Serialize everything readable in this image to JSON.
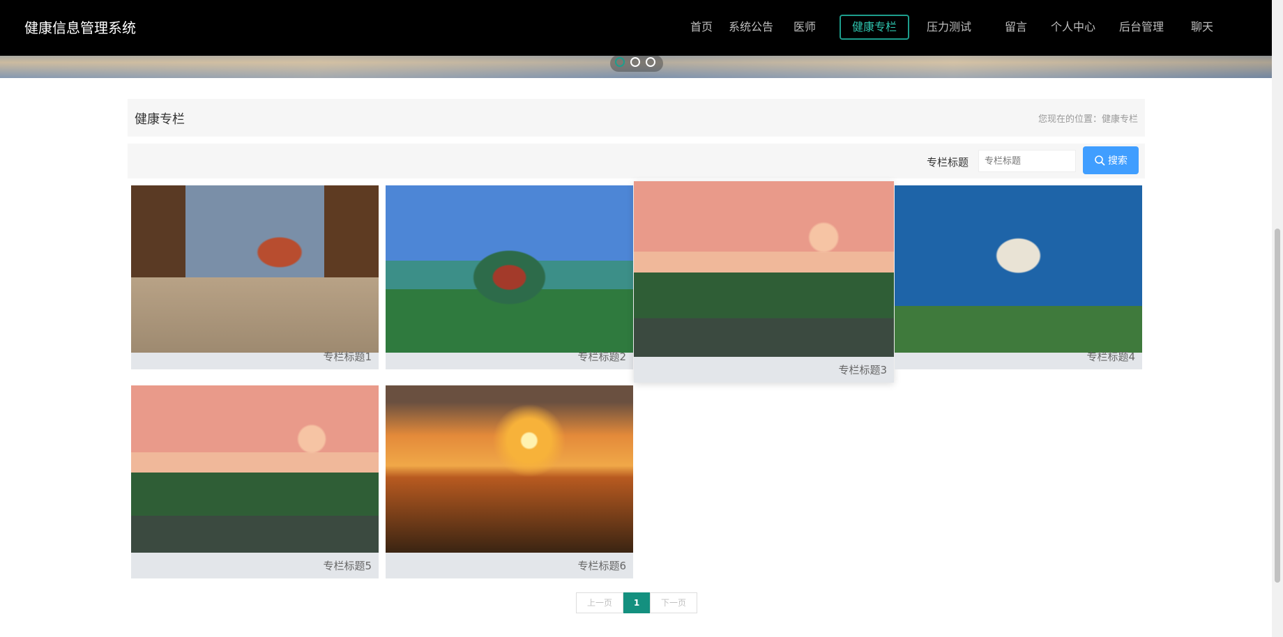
{
  "app": {
    "title": "健康信息管理系统"
  },
  "nav": {
    "items": [
      {
        "label": "首页"
      },
      {
        "label": "系统公告"
      },
      {
        "label": "医师"
      },
      {
        "label": "健康专栏",
        "active": true
      },
      {
        "label": "压力测试"
      },
      {
        "label": "留言"
      },
      {
        "label": "个人中心"
      },
      {
        "label": "后台管理"
      },
      {
        "label": "聊天"
      }
    ],
    "active_color": "#1d9e8d",
    "bar_color": "#000000"
  },
  "banner": {
    "indicator_count": 3,
    "active_index": 0
  },
  "breadcrumb": {
    "title": "健康专栏",
    "location": "您现在的位置：健康专栏"
  },
  "search": {
    "label": "专栏标题",
    "placeholder": "专栏标题",
    "value": "",
    "button_label": "搜索",
    "button_icon": "search-icon",
    "button_color": "#409eff"
  },
  "cards": [
    {
      "title": "专栏标题1",
      "image": "ancient-street-gate"
    },
    {
      "title": "专栏标题2",
      "image": "riverside-pavilion"
    },
    {
      "title": "专栏标题3",
      "image": "temple-sunset"
    },
    {
      "title": "专栏标题4",
      "image": "leaning-tower"
    },
    {
      "title": "专栏标题5",
      "image": "temple-sunset"
    },
    {
      "title": "专栏标题6",
      "image": "sailboat-sunset"
    }
  ],
  "pagination": {
    "prev_label": "上一页",
    "current_page": "1",
    "next_label": "下一页",
    "active_color": "#14907f"
  }
}
